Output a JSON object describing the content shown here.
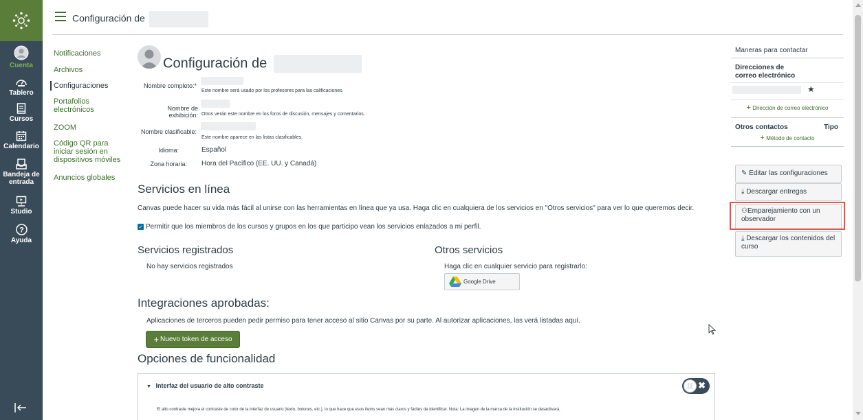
{
  "header": {
    "breadcrumb": "Configuración de"
  },
  "global_nav": {
    "items": [
      {
        "label": "Cuenta",
        "icon": "user-icon"
      },
      {
        "label": "Tablero",
        "icon": "dashboard-icon"
      },
      {
        "label": "Cursos",
        "icon": "courses-icon"
      },
      {
        "label": "Calendario",
        "icon": "calendar-icon"
      },
      {
        "label": "Bandeja de entrada",
        "icon": "inbox-icon"
      },
      {
        "label": "Studio",
        "icon": "studio-icon"
      },
      {
        "label": "Ayuda",
        "icon": "help-icon"
      }
    ]
  },
  "course_nav": {
    "items": [
      {
        "label": "Notificaciones"
      },
      {
        "label": "Archivos"
      },
      {
        "label": "Configuraciones"
      },
      {
        "label": "Portafolios electrónicos"
      },
      {
        "label": "ZOOM"
      },
      {
        "label": "Código QR para iniciar sesión en dispositivos móviles"
      },
      {
        "label": "Anuncios globales"
      }
    ]
  },
  "profile": {
    "title": "Configuración de",
    "full_name_label": "Nombre completo:*",
    "full_name_hint": "Este nombre será usado por los profesores para las calificaciones.",
    "display_name_label": "Nombre de exhibición:",
    "display_name_hint": "Otros verán este nombre en los foros de discusión, mensajes y comentarios.",
    "sortable_name_label": "Nombre clasificable:",
    "sortable_name_hint": "Este nombre aparece en las listas clasificables.",
    "language_label": "Idioma:",
    "language_value": "Español",
    "timezone_label": "Zona horaria:",
    "timezone_value": "Hora del Pacífico (EE. UU. y Canadá)"
  },
  "online_services": {
    "title": "Servicios en línea",
    "description": "Canvas puede hacer su vida más fácil al unirse con las herramientas en línea que ya usa. Haga clic en cualquiera de los servicios en \"Otros servicios\" para ver lo que queremos decir.",
    "checkbox_label": "Permitir que los miembros de los cursos y grupos en los que participo vean los servicios enlazados a mi perfil.",
    "registered_title": "Servicios registrados",
    "registered_empty": "No hay servicios registrados",
    "other_title": "Otros servicios",
    "other_hint": "Haga clic en cualquier servicio para registrarlo:",
    "google_drive": "Google Drive"
  },
  "integrations": {
    "title": "Integraciones aprobadas:",
    "description": "Aplicaciones de terceros pueden pedir permiso para tener acceso al sitio Canvas por su parte. Al autorizar aplicaciones, las verá listadas aquí.",
    "new_token_button": "Nuevo token de acceso"
  },
  "features": {
    "title": "Opciones de funcionalidad",
    "high_contrast_title": "Interfaz del usuario de alto contraste",
    "high_contrast_desc": "El alto contraste mejora el contraste de color de la interfaz de usuario (texto, botones, etc.), lo que hace que esos ítems sean más claros y fáciles de identificar. Nota: La imagen de la marca de la institución se desactivará."
  },
  "sidebar": {
    "contact_title": "Maneras para contactar",
    "email_title": "Direcciones de correo electrónico",
    "add_email": "Dirección de correo electrónico",
    "other_contacts": "Otros contactos",
    "type_col": "Tipo",
    "add_contact_method": "Método de contacto",
    "edit_settings": "Editar las configuraciones",
    "download_submissions": "Descargar entregas",
    "pair_observer": "Emparejamiento con un observador",
    "download_course_content": "Descargar los contenidos del curso"
  },
  "colors": {
    "brand_green": "#5a7d3a",
    "nav_bg": "#394b58",
    "link_green": "#3e6e2b",
    "highlight_red": "#d9534f"
  }
}
